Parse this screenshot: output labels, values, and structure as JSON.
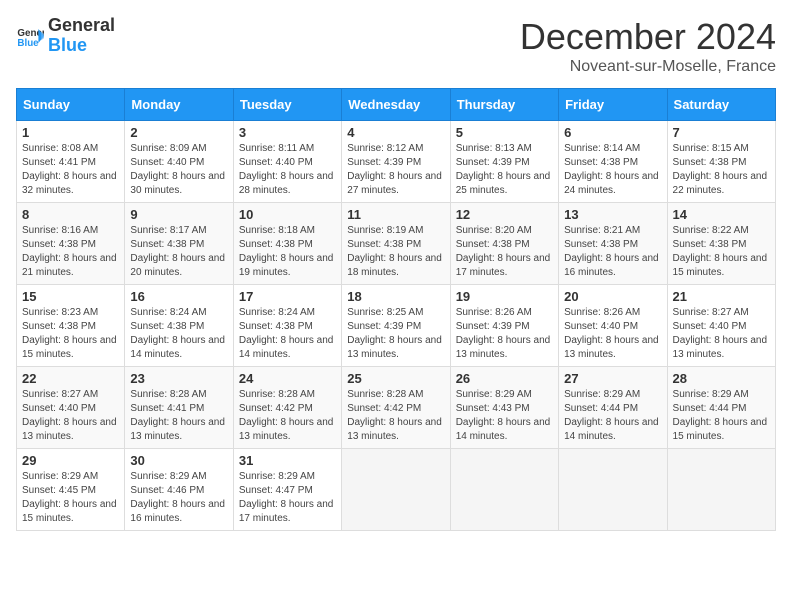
{
  "header": {
    "logo_general": "General",
    "logo_blue": "Blue",
    "title": "December 2024",
    "location": "Noveant-sur-Moselle, France"
  },
  "days_of_week": [
    "Sunday",
    "Monday",
    "Tuesday",
    "Wednesday",
    "Thursday",
    "Friday",
    "Saturday"
  ],
  "weeks": [
    [
      {
        "day": "1",
        "sunrise": "8:08 AM",
        "sunset": "4:41 PM",
        "daylight": "8 hours and 32 minutes."
      },
      {
        "day": "2",
        "sunrise": "8:09 AM",
        "sunset": "4:40 PM",
        "daylight": "8 hours and 30 minutes."
      },
      {
        "day": "3",
        "sunrise": "8:11 AM",
        "sunset": "4:40 PM",
        "daylight": "8 hours and 28 minutes."
      },
      {
        "day": "4",
        "sunrise": "8:12 AM",
        "sunset": "4:39 PM",
        "daylight": "8 hours and 27 minutes."
      },
      {
        "day": "5",
        "sunrise": "8:13 AM",
        "sunset": "4:39 PM",
        "daylight": "8 hours and 25 minutes."
      },
      {
        "day": "6",
        "sunrise": "8:14 AM",
        "sunset": "4:38 PM",
        "daylight": "8 hours and 24 minutes."
      },
      {
        "day": "7",
        "sunrise": "8:15 AM",
        "sunset": "4:38 PM",
        "daylight": "8 hours and 22 minutes."
      }
    ],
    [
      {
        "day": "8",
        "sunrise": "8:16 AM",
        "sunset": "4:38 PM",
        "daylight": "8 hours and 21 minutes."
      },
      {
        "day": "9",
        "sunrise": "8:17 AM",
        "sunset": "4:38 PM",
        "daylight": "8 hours and 20 minutes."
      },
      {
        "day": "10",
        "sunrise": "8:18 AM",
        "sunset": "4:38 PM",
        "daylight": "8 hours and 19 minutes."
      },
      {
        "day": "11",
        "sunrise": "8:19 AM",
        "sunset": "4:38 PM",
        "daylight": "8 hours and 18 minutes."
      },
      {
        "day": "12",
        "sunrise": "8:20 AM",
        "sunset": "4:38 PM",
        "daylight": "8 hours and 17 minutes."
      },
      {
        "day": "13",
        "sunrise": "8:21 AM",
        "sunset": "4:38 PM",
        "daylight": "8 hours and 16 minutes."
      },
      {
        "day": "14",
        "sunrise": "8:22 AM",
        "sunset": "4:38 PM",
        "daylight": "8 hours and 15 minutes."
      }
    ],
    [
      {
        "day": "15",
        "sunrise": "8:23 AM",
        "sunset": "4:38 PM",
        "daylight": "8 hours and 15 minutes."
      },
      {
        "day": "16",
        "sunrise": "8:24 AM",
        "sunset": "4:38 PM",
        "daylight": "8 hours and 14 minutes."
      },
      {
        "day": "17",
        "sunrise": "8:24 AM",
        "sunset": "4:38 PM",
        "daylight": "8 hours and 14 minutes."
      },
      {
        "day": "18",
        "sunrise": "8:25 AM",
        "sunset": "4:39 PM",
        "daylight": "8 hours and 13 minutes."
      },
      {
        "day": "19",
        "sunrise": "8:26 AM",
        "sunset": "4:39 PM",
        "daylight": "8 hours and 13 minutes."
      },
      {
        "day": "20",
        "sunrise": "8:26 AM",
        "sunset": "4:40 PM",
        "daylight": "8 hours and 13 minutes."
      },
      {
        "day": "21",
        "sunrise": "8:27 AM",
        "sunset": "4:40 PM",
        "daylight": "8 hours and 13 minutes."
      }
    ],
    [
      {
        "day": "22",
        "sunrise": "8:27 AM",
        "sunset": "4:40 PM",
        "daylight": "8 hours and 13 minutes."
      },
      {
        "day": "23",
        "sunrise": "8:28 AM",
        "sunset": "4:41 PM",
        "daylight": "8 hours and 13 minutes."
      },
      {
        "day": "24",
        "sunrise": "8:28 AM",
        "sunset": "4:42 PM",
        "daylight": "8 hours and 13 minutes."
      },
      {
        "day": "25",
        "sunrise": "8:28 AM",
        "sunset": "4:42 PM",
        "daylight": "8 hours and 13 minutes."
      },
      {
        "day": "26",
        "sunrise": "8:29 AM",
        "sunset": "4:43 PM",
        "daylight": "8 hours and 14 minutes."
      },
      {
        "day": "27",
        "sunrise": "8:29 AM",
        "sunset": "4:44 PM",
        "daylight": "8 hours and 14 minutes."
      },
      {
        "day": "28",
        "sunrise": "8:29 AM",
        "sunset": "4:44 PM",
        "daylight": "8 hours and 15 minutes."
      }
    ],
    [
      {
        "day": "29",
        "sunrise": "8:29 AM",
        "sunset": "4:45 PM",
        "daylight": "8 hours and 15 minutes."
      },
      {
        "day": "30",
        "sunrise": "8:29 AM",
        "sunset": "4:46 PM",
        "daylight": "8 hours and 16 minutes."
      },
      {
        "day": "31",
        "sunrise": "8:29 AM",
        "sunset": "4:47 PM",
        "daylight": "8 hours and 17 minutes."
      },
      null,
      null,
      null,
      null
    ]
  ],
  "labels": {
    "sunrise": "Sunrise:",
    "sunset": "Sunset:",
    "daylight": "Daylight:"
  }
}
